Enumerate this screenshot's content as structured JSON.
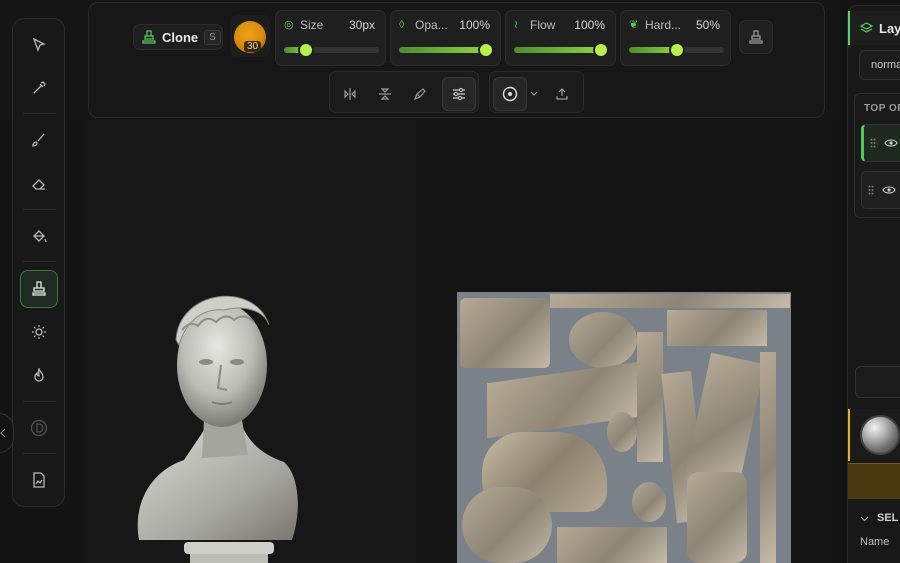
{
  "toolbar": {
    "tool_name": "Clone",
    "tool_shortcut": "S",
    "brush_size_badge": "30",
    "params": [
      {
        "id": "size",
        "label": "Size",
        "value": "30px",
        "fraction": 0.23,
        "icon": "size-icon"
      },
      {
        "id": "opacity",
        "label": "Opa...",
        "value": "100%",
        "fraction": 1.0,
        "icon": "opacity-drop-icon"
      },
      {
        "id": "flow",
        "label": "Flow",
        "value": "100%",
        "fraction": 1.0,
        "icon": "flow-icon"
      },
      {
        "id": "hardness",
        "label": "Hard...",
        "value": "50%",
        "fraction": 0.5,
        "icon": "hardness-leaf-icon"
      }
    ]
  },
  "right_panel": {
    "tab_label": "Laye",
    "blend_mode": "norma",
    "list_header": "TOP OF",
    "section_title": "SEL",
    "field_name_label": "Name"
  },
  "colors": {
    "accent_green": "#b6f04a",
    "active_border": "#4fc85a",
    "brush_orange": "#f0a31a",
    "warning_amber": "#e4b12a"
  }
}
